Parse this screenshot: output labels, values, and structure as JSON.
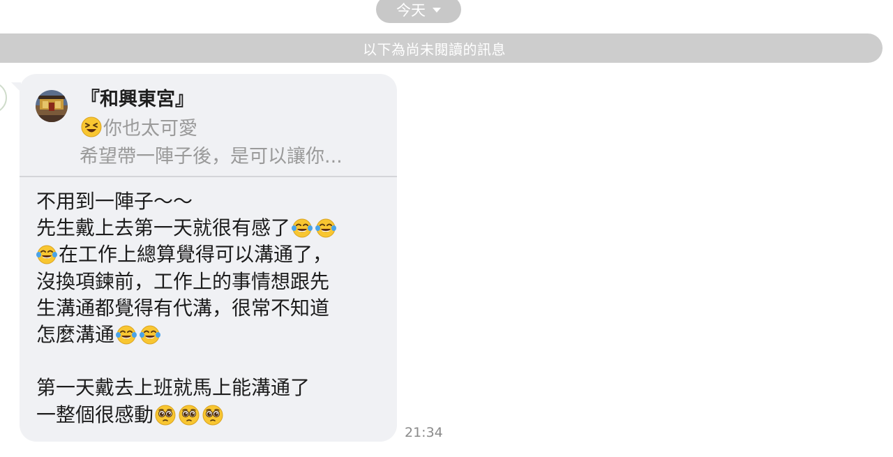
{
  "date_selector": {
    "label": "今天",
    "icon": "chevron-down-icon"
  },
  "unread_divider": {
    "label": "以下為尚未閱讀的訊息"
  },
  "message": {
    "reply": {
      "name": "『和興東宮』",
      "line1": "你也太可愛",
      "line1_emoji": "laughing-squint-emoji",
      "line2": "希望帶一陣子後，是可以讓你..."
    },
    "body": {
      "l1": "不用到一陣子～～",
      "l2": "先生戴上去第一天就很有感了",
      "l3": "在工作上總算覺得可以溝通了，",
      "l4": "沒換項鍊前，工作上的事情想跟先",
      "l5": "生溝通都覺得有代溝，很常不知道",
      "l6": "怎麼溝通",
      "l7": "第一天戴去上班就馬上能溝通了",
      "l8": "一整個很感動"
    },
    "emojis": {
      "tears_of_joy": "face-with-tears-of-joy-emoji",
      "pleading": "pleading-face-emoji"
    },
    "time": "21:34"
  },
  "colors": {
    "bubble": "#f0f1f4",
    "pill": "#c8c8c8",
    "divider_bar": "#cdcdcd",
    "quote_text": "#9a9a9a",
    "emoji_yellow": "#f8c631"
  }
}
